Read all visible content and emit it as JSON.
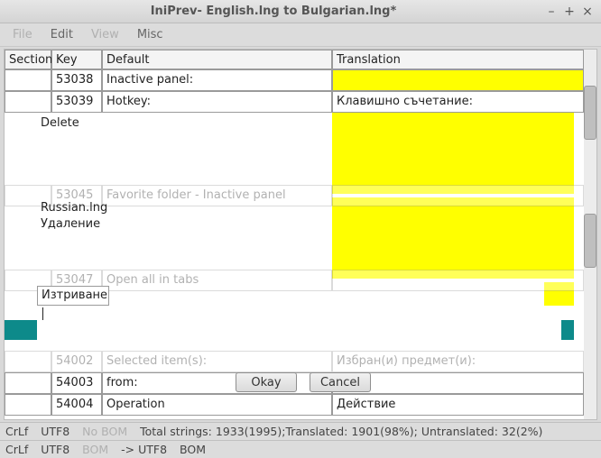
{
  "window": {
    "title": "IniPrev- English.lng to Bulgarian.lng*"
  },
  "menu": {
    "file": "File",
    "edit": "Edit",
    "view": "View",
    "misc": "Misc"
  },
  "headers": {
    "section": "Section",
    "key": "Key",
    "default": "Default",
    "translation": "Translation"
  },
  "rows": [
    {
      "section": "",
      "key": "53038",
      "default": "Inactive panel:",
      "translation": "",
      "hl": true
    },
    {
      "section": "",
      "key": "53039",
      "default": "Hotkey:",
      "translation": "Клавишно съчетание:",
      "hl": false
    }
  ],
  "partial_rows": {
    "r_fav": {
      "key": "53045",
      "default": "Favorite folder - Inactive panel"
    },
    "r_tabs": {
      "key": "53047",
      "default": "Open all in tabs"
    },
    "r_sel": {
      "key": "54002",
      "default": "Selected item(s):",
      "translation": "Избран(и) предмет(и):"
    },
    "r_from": {
      "key": "54003",
      "default": "from:",
      "translation": ""
    },
    "r_op": {
      "key": "54004",
      "default": "Operation",
      "translation": "Действие"
    }
  },
  "overlays": {
    "delete": "Delete",
    "russian": "Russian.lng",
    "udalenie": "Удаление",
    "edit_value": "Изтриване"
  },
  "buttons": {
    "okay": "Okay",
    "cancel": "Cancel"
  },
  "status1": {
    "crlf": "CrLf",
    "utf8": "UTF8",
    "bom": "No BOM",
    "summary": "Total strings: 1933(1995);Translated: 1901(98%); Untranslated: 32(2%)"
  },
  "status2": {
    "crlf": "CrLf",
    "utf8": "UTF8",
    "bom": "BOM",
    "arrow": "-> UTF8",
    "bom2": "BOM"
  }
}
